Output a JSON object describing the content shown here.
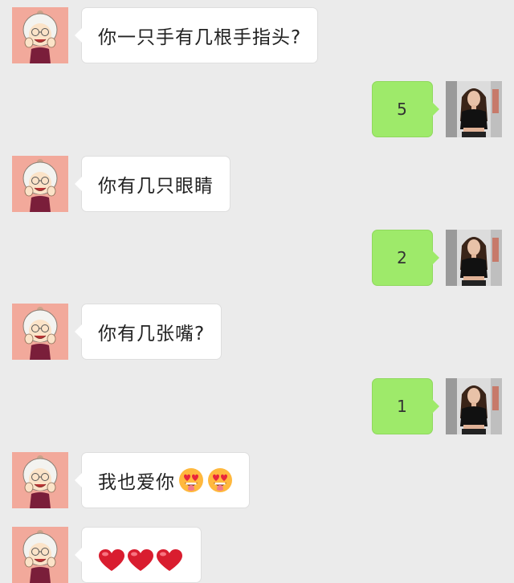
{
  "messages": [
    {
      "side": "in",
      "text": "你一只手有几根手指头?"
    },
    {
      "side": "out",
      "text": "5"
    },
    {
      "side": "in",
      "text": "你有几只眼睛"
    },
    {
      "side": "out",
      "text": "2"
    },
    {
      "side": "in",
      "text": "你有几张嘴?"
    },
    {
      "side": "out",
      "text": "1"
    },
    {
      "side": "in",
      "text": "我也爱你",
      "emoji": [
        "heart-eyes-tongue-emoji",
        "heart-eyes-tongue-emoji"
      ]
    },
    {
      "side": "in",
      "emoji": [
        "red-heart-emoji",
        "red-heart-emoji",
        "red-heart-emoji"
      ]
    }
  ],
  "colors": {
    "background": "#ebebeb",
    "incoming_bubble": "#ffffff",
    "outgoing_bubble": "#9eea6a"
  }
}
